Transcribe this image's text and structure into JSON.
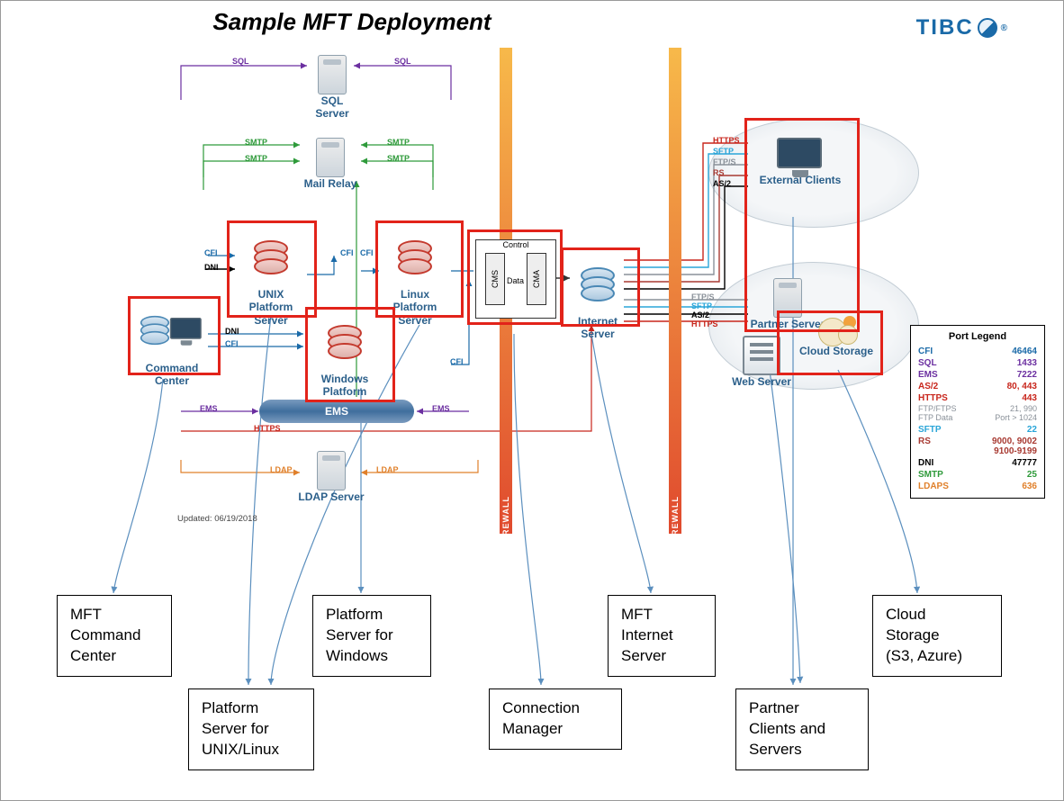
{
  "header": {
    "title": "Sample MFT Deployment",
    "brand": "TIBC"
  },
  "meta": {
    "updated": "Updated: 06/19/2018"
  },
  "nodes": {
    "sql_server": "SQL Server",
    "mail_relay": "Mail Relay",
    "unix_ps": "UNIX\nPlatform\nServer",
    "linux_ps": "Linux\nPlatform\nServer",
    "windows_ps": "Windows\nPlatform\nServer",
    "command_center": "Command\nCenter",
    "internet_server": "Internet\nServer",
    "ems": "EMS",
    "ldap_server": "LDAP Server",
    "external_clients": "External Clients",
    "partner_server": "Partner Server",
    "cloud_storage": "Cloud Storage",
    "web_server": "Web Server",
    "firewall": "FIREWALL",
    "cm_control": "Control",
    "cm_data": "Data",
    "cm_cms": "CMS",
    "cm_cma": "CMA"
  },
  "conn_labels": {
    "sql": "SQL",
    "smtp": "SMTP",
    "cfi": "CFI",
    "dni": "DNI",
    "ems": "EMS",
    "https": "HTTPS",
    "ldap": "LDAP",
    "sftp": "SFTP",
    "ftps": "FTP/S",
    "rs": "RS",
    "as2": "AS/2"
  },
  "callouts": {
    "command_center": "MFT\nCommand\nCenter",
    "unix_linux_ps": "Platform\nServer for\nUNIX/Linux",
    "windows_ps": "Platform\nServer for\nWindows",
    "conn_mgr": "Connection\nManager",
    "internet_server": "MFT\nInternet\nServer",
    "partners": "Partner\nClients and\nServers",
    "cloud": "Cloud\nStorage\n(S3, Azure)"
  },
  "legend": {
    "title": "Port Legend",
    "rows": [
      {
        "name": "CFI",
        "value": "46464",
        "color": "#1a6aa8"
      },
      {
        "name": "SQL",
        "value": "1433",
        "color": "#6b2fa0"
      },
      {
        "name": "EMS",
        "value": "7222",
        "color": "#6b2fa0"
      },
      {
        "name": "AS/2",
        "value": "80, 443",
        "color": "#c8261c"
      },
      {
        "name": "HTTPS",
        "value": "443",
        "color": "#c8261c"
      },
      {
        "name": "FTP/FTPS\nFTP Data",
        "value": "21, 990\nPort > 1024",
        "color": "#8a9199",
        "sub": true
      },
      {
        "name": "SFTP",
        "value": "22",
        "color": "#2aa5d8"
      },
      {
        "name": "RS",
        "value": "9000, 9002\n9100-9199",
        "color": "#a83a32"
      },
      {
        "name": "DNI",
        "value": "47777",
        "color": "#000000"
      },
      {
        "name": "SMTP",
        "value": "25",
        "color": "#2e9a3a"
      },
      {
        "name": "LDAPS",
        "value": "636",
        "color": "#e0802b"
      }
    ]
  }
}
